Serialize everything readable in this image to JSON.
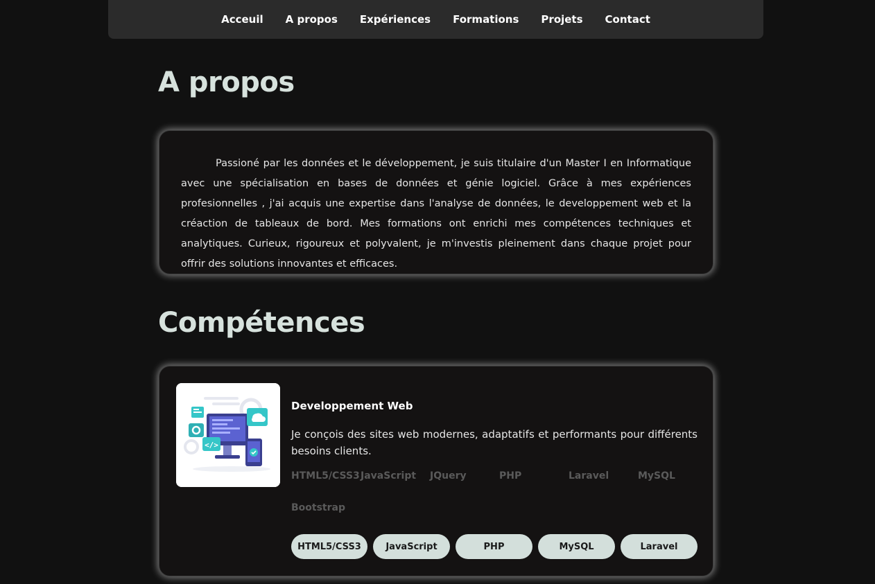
{
  "nav": {
    "items": [
      "Acceuil",
      "A propos",
      "Expériences",
      "Formations",
      "Projets",
      "Contact"
    ]
  },
  "about": {
    "title": "A propos",
    "text": "Passioné par les données et le développement, je suis titulaire d'un Master I en Informatique avec une spécialisation en bases de données et génie logiciel. Grâce à mes expériences profesionnelles , j'ai acquis une expertise dans l'analyse de données, le developpement web et la créaction de tableaux de bord. Mes formations ont enrichi mes compétences techniques et analytiques. Curieux, rigoureux et polyvalent, je m'investis pleinement dans chaque projet pour offrir des solutions innovantes et efficaces."
  },
  "skills": {
    "title": "Compétences",
    "card": {
      "title": "Developpement Web",
      "description": "Je conçois des sites web modernes, adaptatifs et performants pour différents besoins clients.",
      "tech": [
        "HTML5/CSS3",
        "JavaScript",
        "JQuery",
        "PHP",
        "Laravel",
        "MySQL",
        "Bootstrap"
      ],
      "pills": [
        "HTML5/CSS3",
        "JavaScript",
        "PHP",
        "MySQL",
        "Laravel"
      ]
    }
  },
  "colors": {
    "background": "#111111",
    "nav_background": "#2b2b2b",
    "heading": "#d7e2dd",
    "pill": "#d3dfdb"
  }
}
